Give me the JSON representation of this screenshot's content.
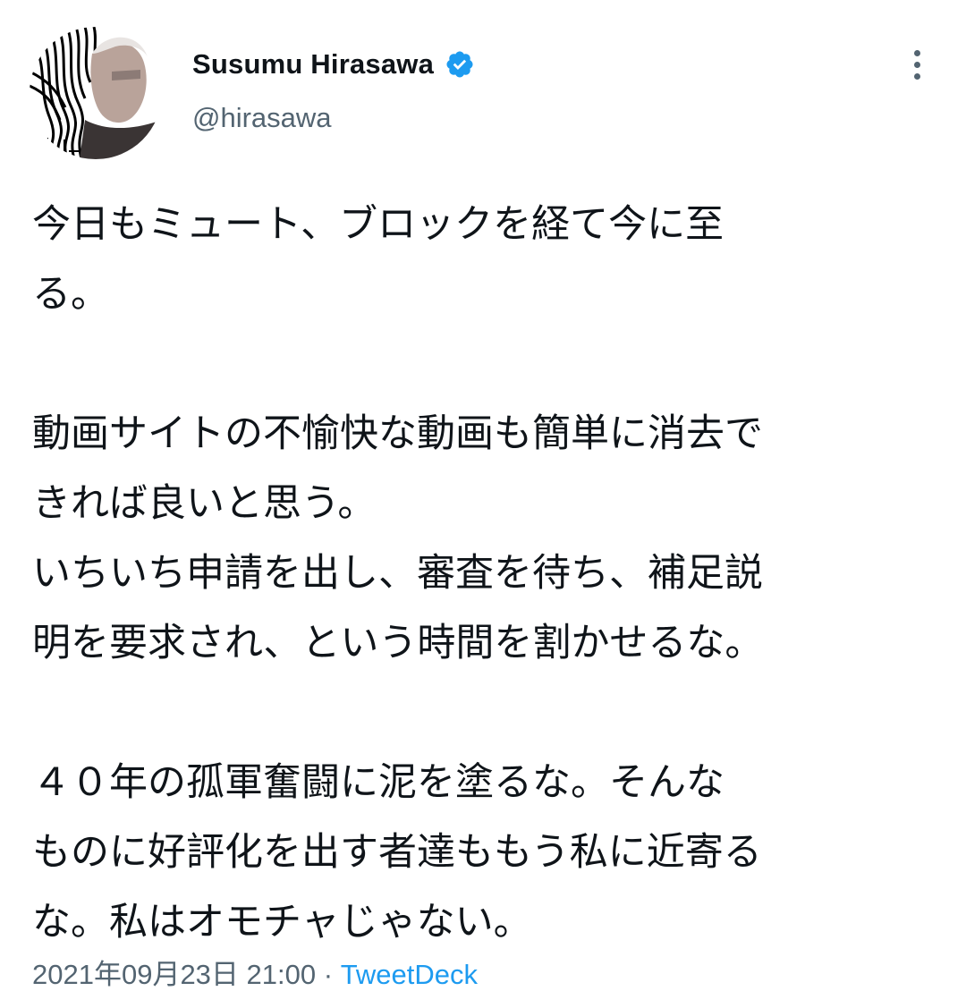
{
  "author": {
    "name": "Susumu Hirasawa",
    "handle": "@hirasawa",
    "verified_icon": "verified-badge-icon",
    "avatar_icon": "avatar-photo",
    "accent_color": "#1d9bf0"
  },
  "menu": {
    "icon": "more-vertical-icon"
  },
  "tweet": {
    "lines": [
      "今日もミュート、ブロックを経て今に至",
      "る。",
      "",
      "動画サイトの不愉快な動画も簡単に消去で",
      "きれば良いと思う。",
      "いちいち申請を出し、審査を待ち、補足説",
      "明を要求され、という時間を割かせるな。",
      "",
      "４０年の孤軍奮闘に泥を塗るな。そんな",
      "ものに好評化を出す者達ももう私に近寄る",
      "な。私はオモチャじゃない。"
    ]
  },
  "meta": {
    "timestamp": "2021年09月23日 21:00",
    "separator": " · ",
    "source": "TweetDeck"
  }
}
